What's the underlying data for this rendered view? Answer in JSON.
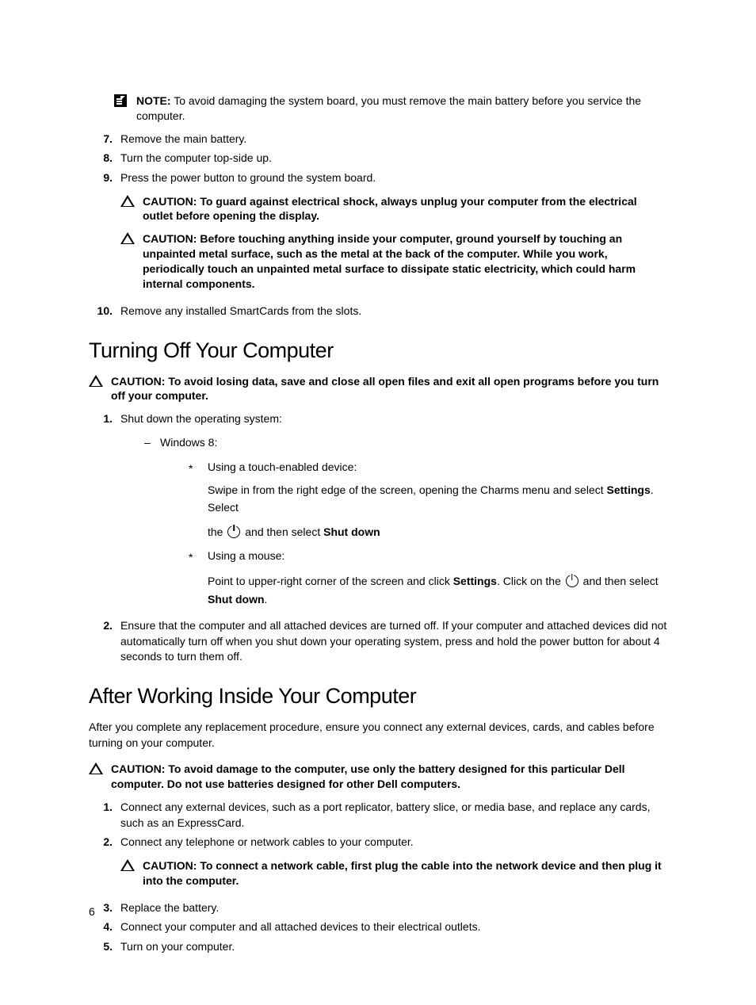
{
  "note": {
    "label": "NOTE:",
    "text": "To avoid damaging the system board, you must remove the main battery before you service the computer."
  },
  "steps_top": {
    "s7": {
      "num": "7.",
      "text": "Remove the main battery."
    },
    "s8": {
      "num": "8.",
      "text": "Turn the computer top-side up."
    },
    "s9": {
      "num": "9.",
      "text": "Press the power button to ground the system board."
    },
    "s10": {
      "num": "10.",
      "text": "Remove any installed SmartCards from the slots."
    }
  },
  "cautions_after9": {
    "c1": {
      "label": "CAUTION:",
      "text": "To guard against electrical shock, always unplug your computer from the electrical outlet before opening the display."
    },
    "c2": {
      "label": "CAUTION:",
      "text": "Before touching anything inside your computer, ground yourself by touching an unpainted metal surface, such as the metal at the back of the computer. While you work, periodically touch an unpainted metal surface to dissipate static electricity, which could harm internal components."
    }
  },
  "section1": {
    "title": "Turning Off Your Computer",
    "caution": {
      "label": "CAUTION:",
      "text": "To avoid losing data, save and close all open files and exit all open programs before you turn off your computer."
    },
    "step1": {
      "num": "1.",
      "text": "Shut down the operating system:"
    },
    "win8": "Windows 8:",
    "touch_label": "Using a touch-enabled device:",
    "touch_a": "Swipe in from the right edge of the screen, opening the Charms menu and select ",
    "touch_b": ". Select",
    "touch_c": "the ",
    "touch_d": " and then select ",
    "settings_bold": "Settings",
    "shutdown_bold": "Shut down",
    "mouse_label": "Using a mouse:",
    "mouse_a": "Point to upper-right corner of the screen and click ",
    "mouse_b": ". Click on the ",
    "mouse_c": " and then select ",
    "shutdown2_a": "Shut",
    "shutdown2_b": "down",
    "period": ".",
    "step2": {
      "num": "2.",
      "text": "Ensure that the computer and all attached devices are turned off. If your computer and attached devices did not automatically turn off when you shut down your operating system, press and hold the power button for about 4 seconds to turn them off."
    }
  },
  "section2": {
    "title": "After Working Inside Your Computer",
    "intro": "After you complete any replacement procedure, ensure you connect any external devices, cards, and cables before turning on your computer.",
    "caution1": {
      "label": "CAUTION:",
      "text": "To avoid damage to the computer, use only the battery designed for this particular Dell computer. Do not use batteries designed for other Dell computers."
    },
    "s1": {
      "num": "1.",
      "text": "Connect any external devices, such as a port replicator, battery slice, or media base, and replace any cards, such as an ExpressCard."
    },
    "s2": {
      "num": "2.",
      "text": "Connect any telephone or network cables to your computer."
    },
    "caution2": {
      "label": "CAUTION:",
      "text": "To connect a network cable, first plug the cable into the network device and then plug it into the computer."
    },
    "s3": {
      "num": "3.",
      "text": "Replace the battery."
    },
    "s4": {
      "num": "4.",
      "text": "Connect your computer and all attached devices to their electrical outlets."
    },
    "s5": {
      "num": "5.",
      "text": "Turn on your computer."
    }
  },
  "page_number": "6"
}
